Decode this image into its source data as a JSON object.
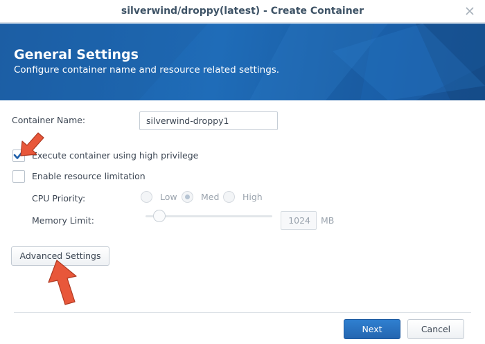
{
  "window": {
    "title": "silverwind/droppy(latest) - Create Container",
    "close_icon": "close-icon"
  },
  "banner": {
    "heading": "General Settings",
    "subheading": "Configure container name and resource related settings."
  },
  "form": {
    "container_name_label": "Container Name:",
    "container_name_value": "silverwind-droppy1",
    "high_privilege_label": "Execute container using high privilege",
    "high_privilege_checked": true,
    "resource_limit_label": "Enable resource limitation",
    "resource_limit_checked": false,
    "cpu_priority_label": "CPU Priority:",
    "cpu_options": [
      "Low",
      "Med",
      "High"
    ],
    "cpu_selected": "Med",
    "memory_limit_label": "Memory Limit:",
    "memory_value": "1024",
    "memory_unit": "MB",
    "advanced_settings_label": "Advanced Settings"
  },
  "footer": {
    "next_label": "Next",
    "cancel_label": "Cancel"
  },
  "colors": {
    "accent": "#2466b0",
    "arrow": "#e8573a"
  }
}
